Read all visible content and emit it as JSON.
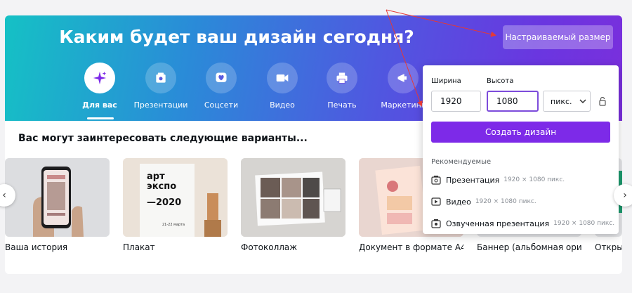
{
  "hero": {
    "title": "Каким будет ваш дизайн сегодня?",
    "custom_size_button": "Настраиваемый размер",
    "categories": [
      {
        "label": "Для вас",
        "icon": "sparkle-icon",
        "active": true
      },
      {
        "label": "Презентации",
        "icon": "presentation-icon"
      },
      {
        "label": "Соцсети",
        "icon": "heart-icon"
      },
      {
        "label": "Видео",
        "icon": "video-camera-icon"
      },
      {
        "label": "Печать",
        "icon": "printer-icon"
      },
      {
        "label": "Маркетинг",
        "icon": "megaphone-icon"
      }
    ]
  },
  "section": {
    "title": "Вас могут заинтересовать следующие варианты..."
  },
  "tiles": [
    {
      "label": "Ваша история"
    },
    {
      "label": "Плакат",
      "poster_title": "арт экспо",
      "poster_year": "—2020",
      "poster_date": "21-22 марта"
    },
    {
      "label": "Фотоколлаж"
    },
    {
      "label": "Документ в формате А4"
    },
    {
      "label": "Баннер (альбомная ориентация)"
    },
    {
      "label": "Открытка"
    }
  ],
  "popover": {
    "width_label": "Ширина",
    "height_label": "Высота",
    "width_value": "1920",
    "height_value": "1080",
    "unit": "пикс.",
    "create_button": "Создать дизайн",
    "recommended_title": "Рекомендуемые",
    "recommended": [
      {
        "name": "Презентация",
        "dims": "1920 × 1080 пикс.",
        "icon": "presentation-icon"
      },
      {
        "name": "Видео",
        "dims": "1920 × 1080 пикс.",
        "icon": "video-icon"
      },
      {
        "name": "Озвученная презентация",
        "dims": "1920 × 1080 пикс.",
        "icon": "voice-presentation-icon"
      }
    ]
  },
  "colors": {
    "primary": "#7d2ae8",
    "arrow": "#e53935",
    "gradient_start": "#15c1c5",
    "gradient_end": "#7a2fdc"
  }
}
